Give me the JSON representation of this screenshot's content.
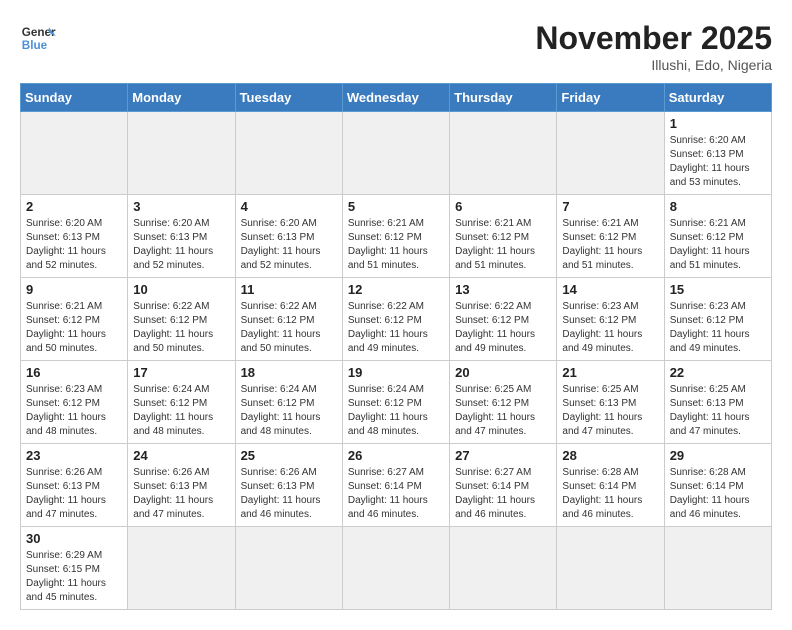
{
  "header": {
    "logo_general": "General",
    "logo_blue": "Blue",
    "month_title": "November 2025",
    "location": "Illushi, Edo, Nigeria"
  },
  "days_of_week": [
    "Sunday",
    "Monday",
    "Tuesday",
    "Wednesday",
    "Thursday",
    "Friday",
    "Saturday"
  ],
  "weeks": [
    [
      {
        "day": "",
        "empty": true
      },
      {
        "day": "",
        "empty": true
      },
      {
        "day": "",
        "empty": true
      },
      {
        "day": "",
        "empty": true
      },
      {
        "day": "",
        "empty": true
      },
      {
        "day": "",
        "empty": true
      },
      {
        "day": "1",
        "sunrise": "6:20 AM",
        "sunset": "6:13 PM",
        "daylight": "11 hours and 53 minutes."
      }
    ],
    [
      {
        "day": "2",
        "sunrise": "6:20 AM",
        "sunset": "6:13 PM",
        "daylight": "11 hours and 52 minutes."
      },
      {
        "day": "3",
        "sunrise": "6:20 AM",
        "sunset": "6:13 PM",
        "daylight": "11 hours and 52 minutes."
      },
      {
        "day": "4",
        "sunrise": "6:20 AM",
        "sunset": "6:13 PM",
        "daylight": "11 hours and 52 minutes."
      },
      {
        "day": "5",
        "sunrise": "6:21 AM",
        "sunset": "6:12 PM",
        "daylight": "11 hours and 51 minutes."
      },
      {
        "day": "6",
        "sunrise": "6:21 AM",
        "sunset": "6:12 PM",
        "daylight": "11 hours and 51 minutes."
      },
      {
        "day": "7",
        "sunrise": "6:21 AM",
        "sunset": "6:12 PM",
        "daylight": "11 hours and 51 minutes."
      },
      {
        "day": "8",
        "sunrise": "6:21 AM",
        "sunset": "6:12 PM",
        "daylight": "11 hours and 51 minutes."
      }
    ],
    [
      {
        "day": "9",
        "sunrise": "6:21 AM",
        "sunset": "6:12 PM",
        "daylight": "11 hours and 50 minutes."
      },
      {
        "day": "10",
        "sunrise": "6:22 AM",
        "sunset": "6:12 PM",
        "daylight": "11 hours and 50 minutes."
      },
      {
        "day": "11",
        "sunrise": "6:22 AM",
        "sunset": "6:12 PM",
        "daylight": "11 hours and 50 minutes."
      },
      {
        "day": "12",
        "sunrise": "6:22 AM",
        "sunset": "6:12 PM",
        "daylight": "11 hours and 49 minutes."
      },
      {
        "day": "13",
        "sunrise": "6:22 AM",
        "sunset": "6:12 PM",
        "daylight": "11 hours and 49 minutes."
      },
      {
        "day": "14",
        "sunrise": "6:23 AM",
        "sunset": "6:12 PM",
        "daylight": "11 hours and 49 minutes."
      },
      {
        "day": "15",
        "sunrise": "6:23 AM",
        "sunset": "6:12 PM",
        "daylight": "11 hours and 49 minutes."
      }
    ],
    [
      {
        "day": "16",
        "sunrise": "6:23 AM",
        "sunset": "6:12 PM",
        "daylight": "11 hours and 48 minutes."
      },
      {
        "day": "17",
        "sunrise": "6:24 AM",
        "sunset": "6:12 PM",
        "daylight": "11 hours and 48 minutes."
      },
      {
        "day": "18",
        "sunrise": "6:24 AM",
        "sunset": "6:12 PM",
        "daylight": "11 hours and 48 minutes."
      },
      {
        "day": "19",
        "sunrise": "6:24 AM",
        "sunset": "6:12 PM",
        "daylight": "11 hours and 48 minutes."
      },
      {
        "day": "20",
        "sunrise": "6:25 AM",
        "sunset": "6:12 PM",
        "daylight": "11 hours and 47 minutes."
      },
      {
        "day": "21",
        "sunrise": "6:25 AM",
        "sunset": "6:13 PM",
        "daylight": "11 hours and 47 minutes."
      },
      {
        "day": "22",
        "sunrise": "6:25 AM",
        "sunset": "6:13 PM",
        "daylight": "11 hours and 47 minutes."
      }
    ],
    [
      {
        "day": "23",
        "sunrise": "6:26 AM",
        "sunset": "6:13 PM",
        "daylight": "11 hours and 47 minutes."
      },
      {
        "day": "24",
        "sunrise": "6:26 AM",
        "sunset": "6:13 PM",
        "daylight": "11 hours and 47 minutes."
      },
      {
        "day": "25",
        "sunrise": "6:26 AM",
        "sunset": "6:13 PM",
        "daylight": "11 hours and 46 minutes."
      },
      {
        "day": "26",
        "sunrise": "6:27 AM",
        "sunset": "6:14 PM",
        "daylight": "11 hours and 46 minutes."
      },
      {
        "day": "27",
        "sunrise": "6:27 AM",
        "sunset": "6:14 PM",
        "daylight": "11 hours and 46 minutes."
      },
      {
        "day": "28",
        "sunrise": "6:28 AM",
        "sunset": "6:14 PM",
        "daylight": "11 hours and 46 minutes."
      },
      {
        "day": "29",
        "sunrise": "6:28 AM",
        "sunset": "6:14 PM",
        "daylight": "11 hours and 46 minutes."
      }
    ],
    [
      {
        "day": "30",
        "sunrise": "6:29 AM",
        "sunset": "6:15 PM",
        "daylight": "11 hours and 45 minutes."
      },
      {
        "day": "",
        "empty": true
      },
      {
        "day": "",
        "empty": true
      },
      {
        "day": "",
        "empty": true
      },
      {
        "day": "",
        "empty": true
      },
      {
        "day": "",
        "empty": true
      },
      {
        "day": "",
        "empty": true
      }
    ]
  ]
}
